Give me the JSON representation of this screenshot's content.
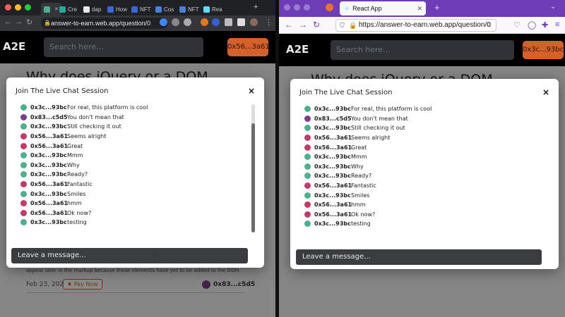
{
  "colors": {
    "accent": "#d6602a",
    "header": "#000000",
    "firefox_purple": "#6f3cb8"
  },
  "avatars": {
    "0x3c...93bc": "#4fae8e",
    "0x83...c5d5": "#7b3e8a",
    "0x56...3a61": "#c23a6a"
  },
  "chrome": {
    "tabs": [
      {
        "label": "",
        "fav": "#4fae8e"
      },
      {
        "label": "Cre",
        "fav": "#28a9a0"
      },
      {
        "label": "dap",
        "fav": "#e8e8e8"
      },
      {
        "label": "How",
        "fav": "#3a66d8"
      },
      {
        "label": "NFT",
        "fav": "#3a66d8"
      },
      {
        "label": "Cos",
        "fav": "#4a7fd6"
      },
      {
        "label": "NFT",
        "fav": "#4a7fd6"
      },
      {
        "label": "Rea",
        "fav": "#61dafb"
      }
    ],
    "url": "answer-to-earn.web.app/question/0"
  },
  "firefox": {
    "tab_title": "React App",
    "url": "https://answer-to-earn.web.app/question/0"
  },
  "app": {
    "logo": "A2E",
    "search_placeholder": "Search here...",
    "account_left": "0x56...3a61",
    "account_right": "0x3c...93bc",
    "question_title": "Why does jQuery or a DOM",
    "question_text": "appear later in the markup because those elements have yet to be added to the DOM.",
    "question_date": "Feb 23, 2023",
    "pay_label": "Pay Now",
    "question_author": "0x83...c5d5"
  },
  "chat": {
    "title": "Join The Live Chat Session",
    "close": "×",
    "input_placeholder": "Leave a message...",
    "messages": [
      {
        "addr": "0x3c...93bc",
        "text": "For real, this platform is cool"
      },
      {
        "addr": "0x83...c5d5",
        "text": "You don't mean that"
      },
      {
        "addr": "0x3c...93bc",
        "text": "Still checking it out"
      },
      {
        "addr": "0x56...3a61",
        "text": "Seems alright"
      },
      {
        "addr": "0x56...3a61",
        "text": "Great"
      },
      {
        "addr": "0x3c...93bc",
        "text": "Mmm"
      },
      {
        "addr": "0x3c...93bc",
        "text": "Why"
      },
      {
        "addr": "0x3c...93bc",
        "text": "Ready?"
      },
      {
        "addr": "0x56...3a61",
        "text": "Fantastic"
      },
      {
        "addr": "0x3c...93bc",
        "text": "Smiles"
      },
      {
        "addr": "0x56...3a61",
        "text": "hmm"
      },
      {
        "addr": "0x56...3a61",
        "text": "Ok now?"
      },
      {
        "addr": "0x3c...93bc",
        "text": "testing"
      }
    ]
  }
}
